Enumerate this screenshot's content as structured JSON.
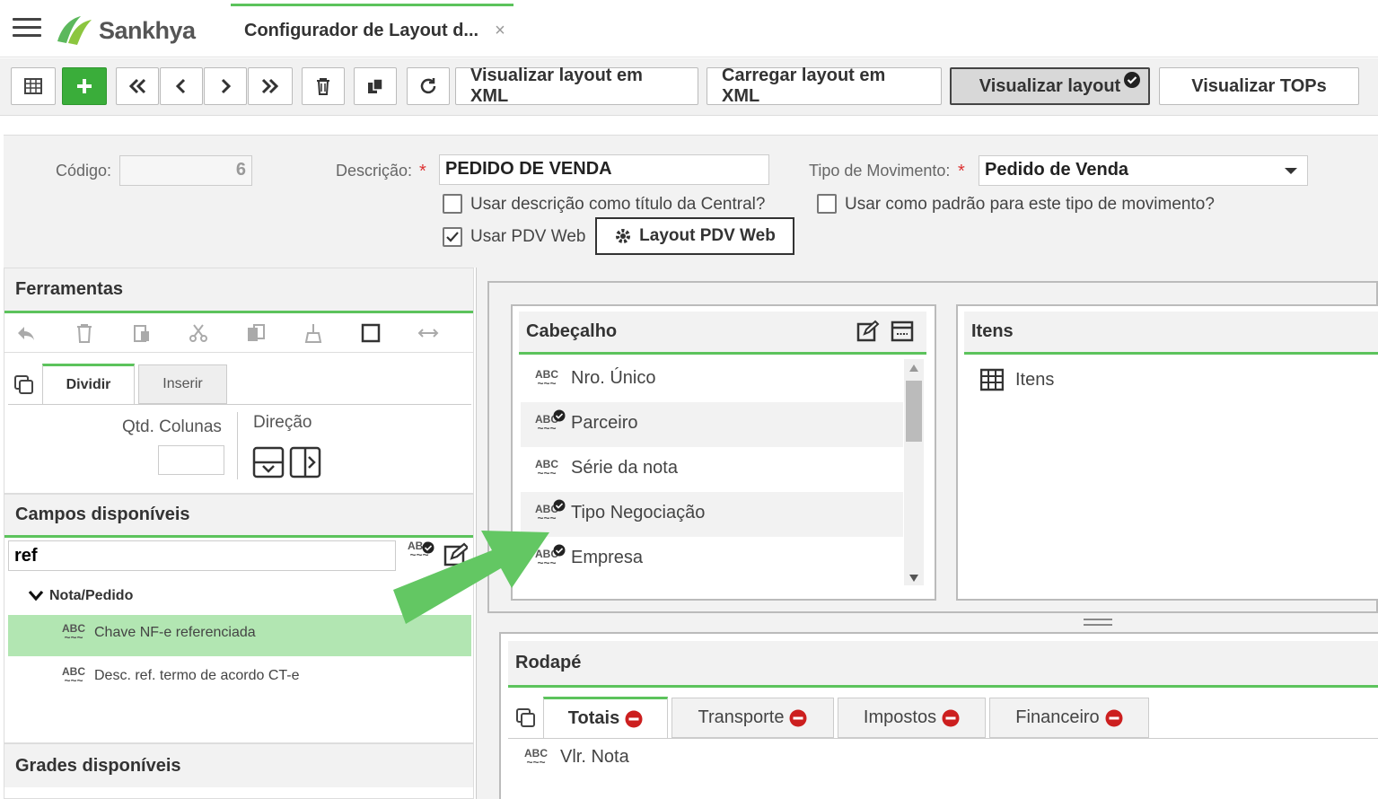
{
  "app": {
    "logo": "Sankhya",
    "tab_title": "Configurador de Layout d...",
    "tab_close": "×"
  },
  "toolbar": {
    "btn_xml_view": "Visualizar layout em XML",
    "btn_xml_load": "Carregar layout em XML",
    "btn_layout_view": "Visualizar layout",
    "btn_tops": "Visualizar TOPs"
  },
  "form": {
    "codigo_label": "Código:",
    "codigo_value": "6",
    "descricao_label": "Descrição:",
    "descricao_value": "PEDIDO DE VENDA",
    "required": "*",
    "tipo_label": "Tipo de Movimento:",
    "tipo_value": "Pedido de Venda",
    "chk_titulo": "Usar descrição como título da Central?",
    "chk_padrao": "Usar como padrão para este tipo de movimento?",
    "chk_pdv": "Usar PDV Web",
    "chk_pdv_checked": true,
    "btn_layout_pdv": "Layout PDV Web"
  },
  "ferramentas": {
    "title": "Ferramentas",
    "tab_dividir": "Dividir",
    "tab_inserir": "Inserir",
    "qtd_colunas": "Qtd. Colunas",
    "direcao": "Direção"
  },
  "campos": {
    "title": "Campos disponíveis",
    "search_value": "ref",
    "group": "Nota/Pedido",
    "items": [
      {
        "label": "Chave NF-e referenciada",
        "selected": true
      },
      {
        "label": "Desc. ref. termo de acordo CT-e",
        "selected": false
      }
    ]
  },
  "grades": {
    "title": "Grades disponíveis"
  },
  "cabecalho": {
    "title": "Cabeçalho",
    "fields": [
      {
        "label": "Nro. Único",
        "checked": false
      },
      {
        "label": "Parceiro",
        "checked": true
      },
      {
        "label": "Série da nota",
        "checked": false
      },
      {
        "label": "Tipo Negociação",
        "checked": true
      },
      {
        "label": "Empresa",
        "checked": true
      }
    ]
  },
  "itens": {
    "title": "Itens",
    "grid_label": "Itens"
  },
  "rodape": {
    "title": "Rodapé",
    "tabs": [
      "Totais",
      "Transporte",
      "Impostos",
      "Financeiro"
    ],
    "fields": [
      {
        "label": "Vlr. Nota"
      }
    ]
  },
  "colors": {
    "accent": "#5cc35c",
    "danger": "#cc1f1f",
    "selected_row": "#b2e6b2"
  }
}
